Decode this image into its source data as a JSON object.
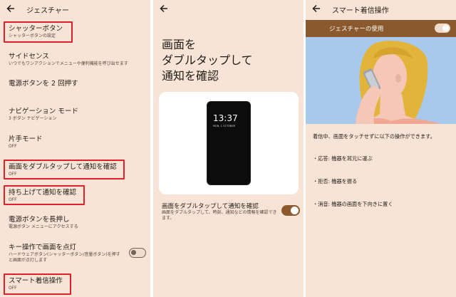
{
  "panel1": {
    "title": "ジェスチャー",
    "items": [
      {
        "title": "シャッターボタン",
        "subtitle": "シャッターボタンの設定"
      },
      {
        "title": "サイドセンス",
        "subtitle": "いつでもワンアクションでメニューや便利機能を呼び出せます"
      },
      {
        "title": "電源ボタンを 2 回押す",
        "subtitle": ""
      },
      {
        "title": "ナビゲーション モード",
        "subtitle": "3 ボタン ナビゲーション"
      },
      {
        "title": "片手モード",
        "subtitle": "OFF"
      },
      {
        "title": "画面をダブルタップして通知を確認",
        "subtitle": "OFF"
      },
      {
        "title": "持ち上げて通知を確認",
        "subtitle": "OFF"
      },
      {
        "title": "電源ボタンを長押し",
        "subtitle": "電源ボタン メニューにアクセスする"
      },
      {
        "title": "キー操作で画面を点灯",
        "subtitle": "ハードウェアボタン(シャッターボタン/音量ボタン)を押すと画面が点灯します"
      },
      {
        "title": "スマート着信操作",
        "subtitle": "OFF"
      }
    ]
  },
  "panel2": {
    "heading": "画面を\nダブルタップして\n通知を確認",
    "phone_time": "13:37",
    "phone_date": "MON, 1 OCTOBER",
    "setting_title": "画面をダブルタップして通知を確認",
    "setting_subtitle": "画面をダブルタップして、時刻、通知などの情報を確認できます。"
  },
  "panel3": {
    "title": "スマート着信操作",
    "toggle_label": "ジェスチャーの使用",
    "intro": "着信中、画面をタッチせずに以下の操作ができます。",
    "bullets": [
      "・応答: 機器を耳元に運ぶ",
      "・拒否: 機器を振る",
      "・消音: 機器の画面を下向きに置く"
    ]
  },
  "colors": {
    "panel_bg": "#f8e4d6",
    "accent_brown": "#8a5a2e",
    "highlight_red": "#e0212a",
    "illustration_blue": "#a8c8ec",
    "hair_yellow": "#e2b43a"
  },
  "icons": [
    "back-arrow-icon",
    "toggle-switch"
  ]
}
